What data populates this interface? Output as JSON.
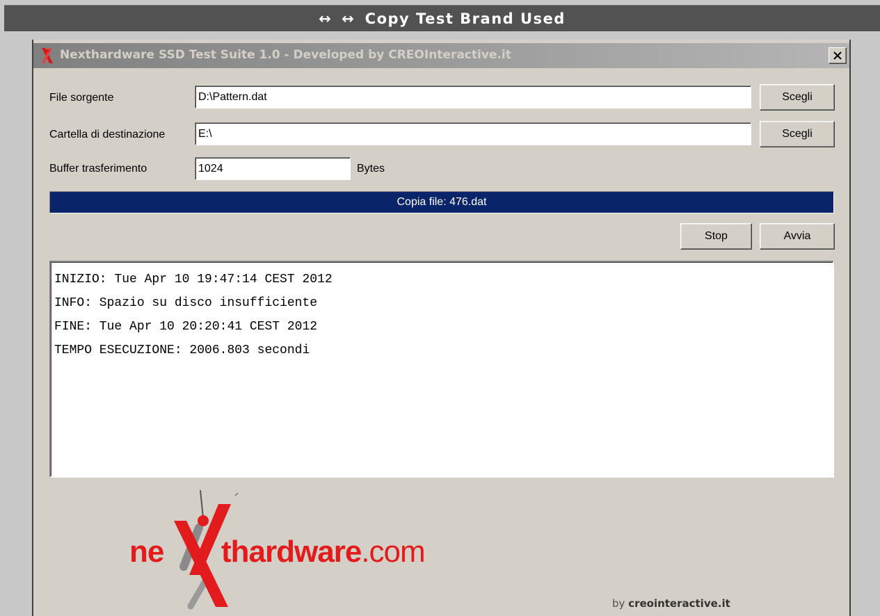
{
  "page_header": {
    "icon": "↔ ↔",
    "title": "Copy Test Brand Used"
  },
  "window": {
    "title": "Nexthardware SSD Test Suite 1.0 - Developed by CREOInteractive.it",
    "close_label": "✕"
  },
  "form": {
    "source_label": "File sorgente",
    "source_value": "D:\\Pattern.dat",
    "source_button": "Scegli",
    "dest_label": "Cartella di destinazione",
    "dest_value": "E:\\",
    "dest_button": "Scegli",
    "buffer_label": "Buffer trasferimento",
    "buffer_value": "1024",
    "buffer_unit": "Bytes"
  },
  "progress": {
    "text": "Copia file: 476.dat",
    "fraction": 1.0
  },
  "actions": {
    "stop_label": "Stop",
    "start_label": "Avvia"
  },
  "log": {
    "lines": [
      "INIZIO: Tue Apr 10 19:47:14 CEST 2012",
      "INFO: Spazio su disco insufficiente",
      "FINE: Tue Apr 10 20:20:41 CEST 2012",
      "TEMPO ESECUZIONE: 2006.803 secondi"
    ]
  },
  "branding": {
    "logo_prefix": "ne",
    "logo_main": "thardware",
    "logo_suffix": ".com",
    "byline_prefix": "by ",
    "byline_name": "creointeractive.it"
  },
  "colors": {
    "progress_fill": "#0a246a",
    "logo_red": "#e21c1c",
    "titlebar_start": "#808080",
    "titlebar_end": "#b5b5b5"
  },
  "icons": {
    "app": "x-logo-icon",
    "close": "close-icon"
  }
}
